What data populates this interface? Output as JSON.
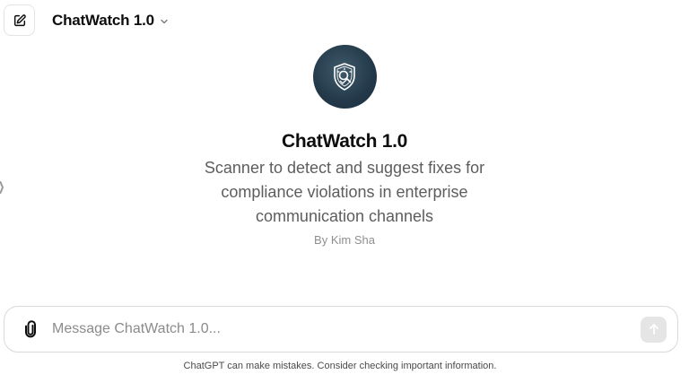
{
  "header": {
    "model_title": "ChatWatch 1.0",
    "new_chat_icon": "pencil-square-icon",
    "dropdown_icon": "chevron-down-icon"
  },
  "gpt": {
    "avatar_icon": "shield-magnifier-icon",
    "name": "ChatWatch 1.0",
    "description": "Scanner to detect and suggest fixes for compliance violations in enterprise communication channels",
    "author": "By Kim Sha"
  },
  "composer": {
    "placeholder": "Message ChatWatch 1.0...",
    "value": "",
    "attach_icon": "paperclip-icon",
    "send_icon": "arrow-up-icon"
  },
  "footer": {
    "disclaimer": "ChatGPT can make mistakes. Consider checking important information."
  },
  "colors": {
    "avatar_bg": "#23394a",
    "text_primary": "#0d0d0d",
    "text_secondary": "#5d5d5d",
    "send_disabled": "#e5e5e5"
  }
}
